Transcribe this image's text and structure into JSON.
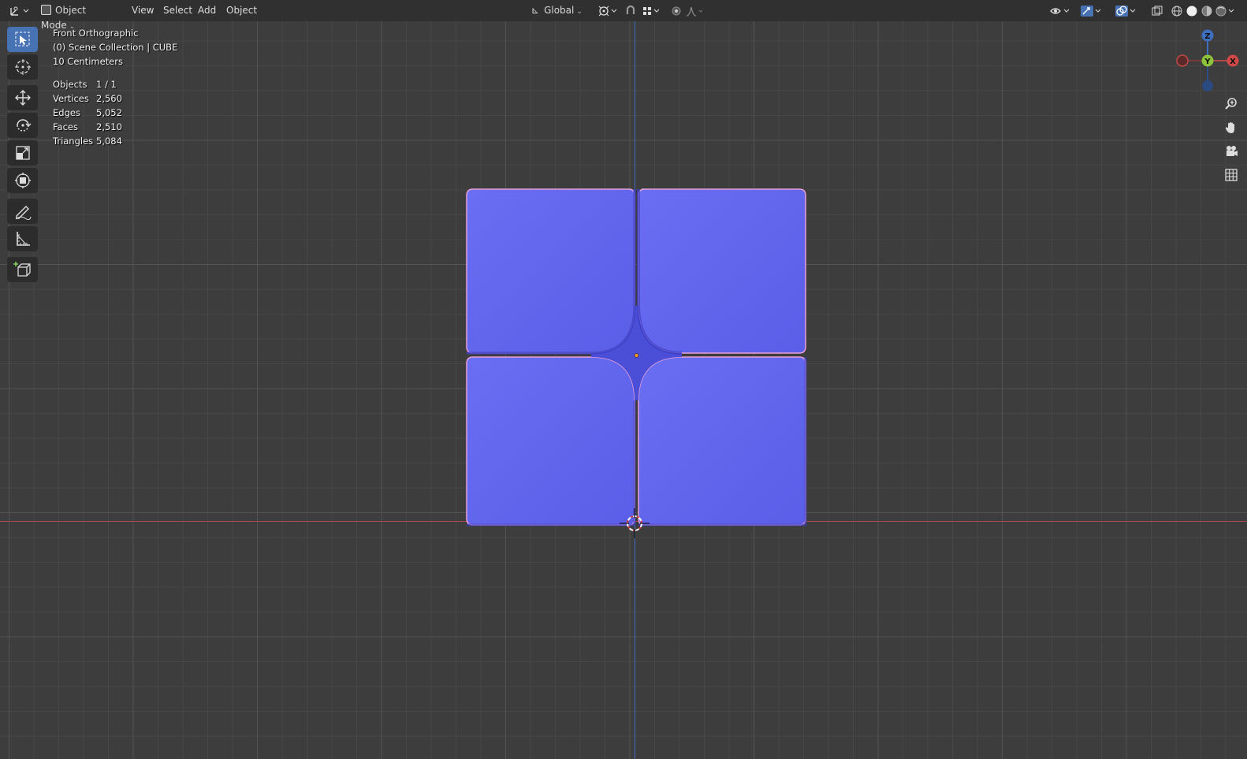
{
  "header": {
    "mode_label": "Object Mode",
    "menus": [
      "View",
      "Select",
      "Add",
      "Object"
    ],
    "transform_orientation": "Global"
  },
  "viewport_info": {
    "view_name": "Front Orthographic",
    "collection": "(0) Scene Collection | CUBE",
    "scale": "10 Centimeters"
  },
  "stats": [
    {
      "label": "Objects",
      "value": "1 / 1"
    },
    {
      "label": "Vertices",
      "value": "2,560"
    },
    {
      "label": "Edges",
      "value": "5,052"
    },
    {
      "label": "Faces",
      "value": "2,510"
    },
    {
      "label": "Triangles",
      "value": "5,084"
    }
  ],
  "gizmo": {
    "z": "Z",
    "y": "Y",
    "x": "X"
  },
  "tools": [
    "select-box-icon",
    "cursor-icon",
    "move-icon",
    "rotate-icon",
    "scale-icon",
    "transform-icon",
    "annotate-icon",
    "measure-icon",
    "add-cube-icon"
  ],
  "colors": {
    "mesh": "#6a6ef0",
    "selection_outline": "#f0a060",
    "x_axis": "#b04a4a",
    "z_axis": "#3d6ec0",
    "active_tool": "#4772b3"
  }
}
